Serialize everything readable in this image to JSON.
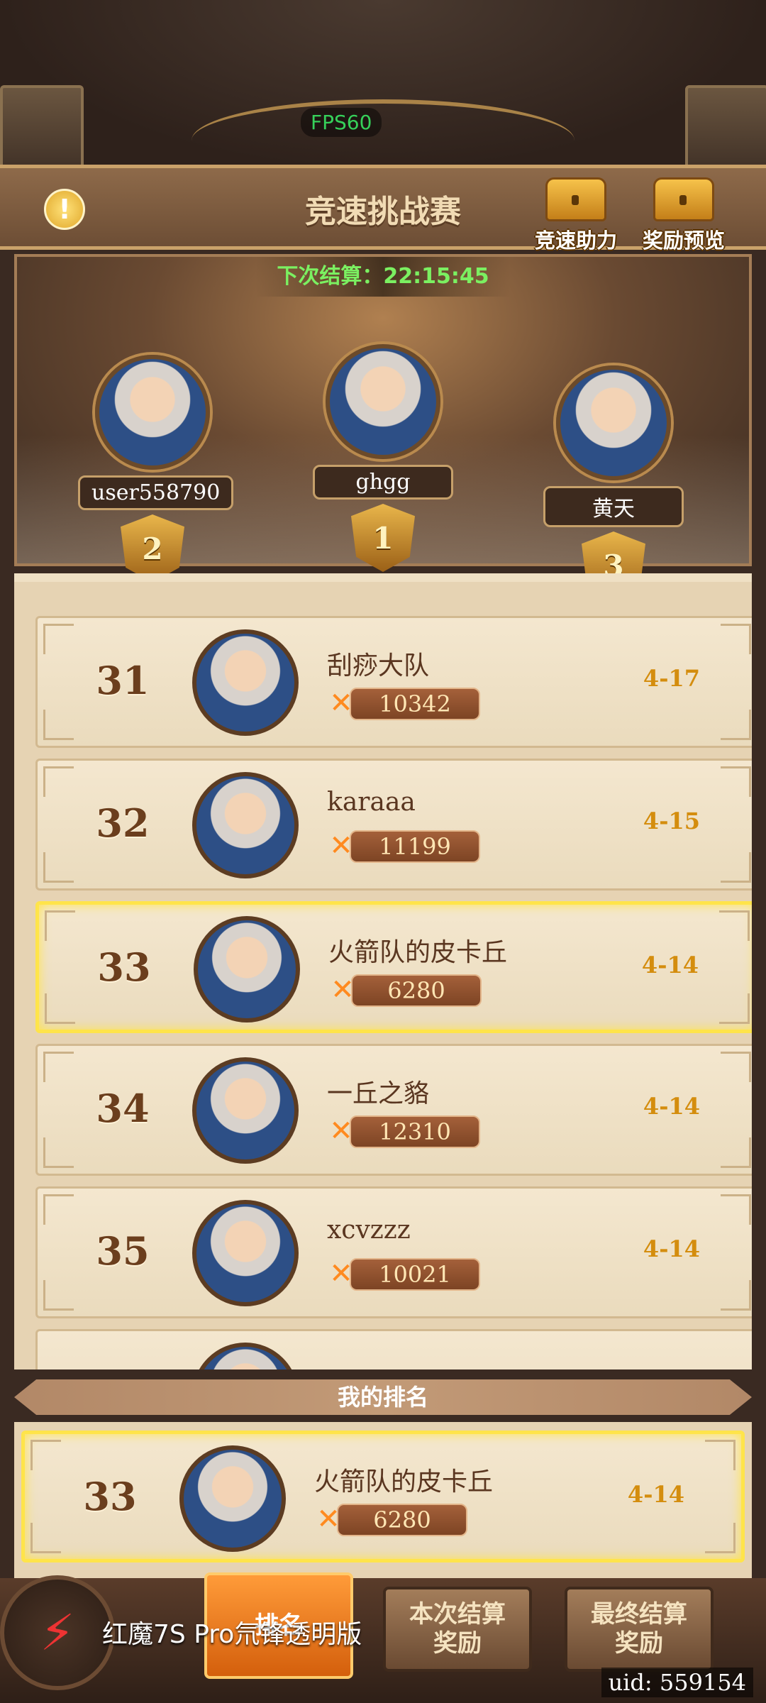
{
  "system": {
    "fps": "FPS60"
  },
  "header": {
    "title": "竞速挑战赛",
    "speed_boost_label": "竞速助力",
    "reward_preview_label": "奖励预览"
  },
  "arena": {
    "countdown": "下次结算：22:15:45",
    "podium": [
      {
        "rank": "2",
        "name": "user558790"
      },
      {
        "rank": "1",
        "name": "ghgg"
      },
      {
        "rank": "3",
        "name": "黄天"
      }
    ]
  },
  "rankings": [
    {
      "rank": "31",
      "name": "刮痧大队",
      "power": "10342",
      "stage": "4-17",
      "highlight": false
    },
    {
      "rank": "32",
      "name": "karaaa",
      "power": "11199",
      "stage": "4-15",
      "highlight": false
    },
    {
      "rank": "33",
      "name": "火箭队的皮卡丘",
      "power": "6280",
      "stage": "4-14",
      "highlight": true
    },
    {
      "rank": "34",
      "name": "一丘之貉",
      "power": "12310",
      "stage": "4-14",
      "highlight": false
    },
    {
      "rank": "35",
      "name": "xcvzzz",
      "power": "10021",
      "stage": "4-14",
      "highlight": false
    }
  ],
  "my_rank": {
    "label": "我的排名",
    "rank": "33",
    "name": "火箭队的皮卡丘",
    "power": "6280",
    "stage": "4-14"
  },
  "tabs": {
    "ranking": "排名",
    "current_reward_line1": "本次结算",
    "current_reward_line2": "奖励",
    "final_reward_line1": "最终结算",
    "final_reward_line2": "奖励"
  },
  "overlay": {
    "watermark": "红魔7S Pro氘锋透明版",
    "uid": "uid: 559154"
  }
}
